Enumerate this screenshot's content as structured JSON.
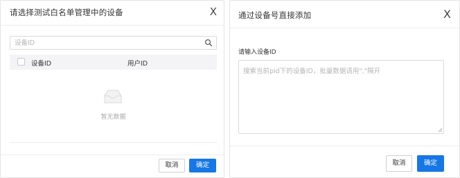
{
  "left_dialog": {
    "title": "请选择测试白名单管理中的设备",
    "close_label": "X",
    "search": {
      "placeholder": "设备ID",
      "value": ""
    },
    "table": {
      "columns": [
        "设备ID",
        "用户ID"
      ],
      "rows": [],
      "empty_text": "暂无数据"
    },
    "footer": {
      "cancel_label": "取消",
      "confirm_label": "确定"
    }
  },
  "right_dialog": {
    "title": "通过设备号直接添加",
    "close_label": "X",
    "field_label": "请输入设备ID",
    "textarea": {
      "placeholder": "搜索当前pid下的设备ID，批量数据请用\",\"隔开",
      "value": ""
    },
    "footer": {
      "cancel_label": "取消",
      "confirm_label": "确定"
    }
  },
  "colors": {
    "primary": "#1677e6",
    "border": "#d9d9d9",
    "table_header_bg": "#f4f4f6",
    "placeholder": "#b4b4b4"
  },
  "icons": [
    "close-icon",
    "search-icon",
    "empty-box-icon",
    "resize-grip-icon"
  ]
}
